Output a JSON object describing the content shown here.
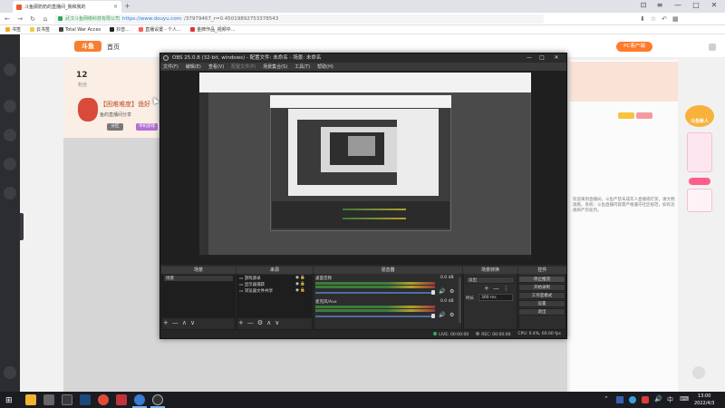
{
  "browser": {
    "tab_title": "斗鱼顾奶奶的直播间_我和我的",
    "tab_close": "×",
    "new_tab": "+",
    "url_owner": "武汉斗鱼网络科技有限公司",
    "url_link": "https://www.douyu.com",
    "url_path": "/37979467_r=0.45019892753378543",
    "window_buttons": [
      "⊡",
      "≡",
      "—",
      "□",
      "✕"
    ],
    "nav": [
      "←",
      "→",
      "↻",
      "⌂"
    ],
    "bookmarks": [
      {
        "label": "书签",
        "color": "#f5a623"
      },
      {
        "label": "云书签",
        "color": "#f5c842"
      },
      {
        "label": "Total War Acces",
        "color": "#444444"
      },
      {
        "label": "抖音…",
        "color": "#222222"
      },
      {
        "label": "直播设置 - 个人…",
        "color": "#ff5a5a"
      },
      {
        "label": "金牌作品_视频中…",
        "color": "#e03333"
      }
    ]
  },
  "site": {
    "logo": "斗鱼",
    "nav_home": "首页",
    "pc_button": "PC客户端",
    "level_num": "12",
    "level_unit": "粉丝",
    "room_title": "【困难难度】诡好",
    "room_sub": "鱼的直播间分享",
    "room_tags": [
      "分区",
      "单机游戏"
    ],
    "notice": "欢迎来到直播间，斗鱼严禁未成年人直播或打赏，请文明观看。系统：斗鱼直播内容需严格遵守社区规范，如有违规将严厉处罚。",
    "promo_text": "斗鱼新人"
  },
  "obs": {
    "title": "OBS 25.0.8 (32-bit, windows) - 配置文件: 未命名 - 场景: 未命名",
    "window_buttons": [
      "—",
      "□",
      "✕"
    ],
    "menu": [
      "文件(F)",
      "编辑(E)",
      "查看(V)",
      "配置文件(P)",
      "场景集合(S)",
      "工具(T)",
      "帮助(H)"
    ],
    "docks": {
      "scenes": {
        "title": "场景",
        "items": [
          "场景"
        ]
      },
      "sources": {
        "title": "来源",
        "items": [
          "游戏源录",
          "显示器捕获",
          "浏览器文件共享"
        ]
      },
      "mixer": {
        "title": "混音器",
        "channels": [
          {
            "label": "桌面音频",
            "db": "0.0 dB"
          },
          {
            "label": "麦克风/Aux",
            "db": "0.0 dB"
          }
        ]
      },
      "transitions": {
        "title": "场景转换",
        "selected": "淡出",
        "duration_label": "时长",
        "duration_value": "300 ms"
      },
      "controls": {
        "title": "控件",
        "buttons": [
          "停止推流",
          "开始录制",
          "工作室模式",
          "设置",
          "退出"
        ]
      }
    },
    "dock_foot": [
      "+",
      "—",
      "∧",
      "∨"
    ],
    "dock_foot_src": [
      "+",
      "—",
      "⚙",
      "∧",
      "∨"
    ],
    "transition_foot": [
      "+",
      "—",
      "⋮"
    ],
    "status": {
      "live": "LIVE: 00:00:00",
      "rec": "REC: 00:00:00",
      "cpu": "CPU: 0.4%, 60.00 fps"
    }
  },
  "taskbar": {
    "start": "⊞",
    "apps": [
      {
        "name": "file-explorer",
        "color": "#f3b330"
      },
      {
        "name": "app-2",
        "color": "#666666"
      },
      {
        "name": "steam",
        "color": "#1b4a7a"
      },
      {
        "name": "app-4",
        "color": "#e24b3b"
      },
      {
        "name": "app-5",
        "color": "#c0353b"
      },
      {
        "name": "browser",
        "color": "#3a7bd5"
      },
      {
        "name": "obs",
        "color": "#333333"
      }
    ],
    "tray": [
      "⌃",
      "🔊",
      "中",
      "⌨"
    ],
    "time": "13:00",
    "date": "2022/4/3"
  }
}
